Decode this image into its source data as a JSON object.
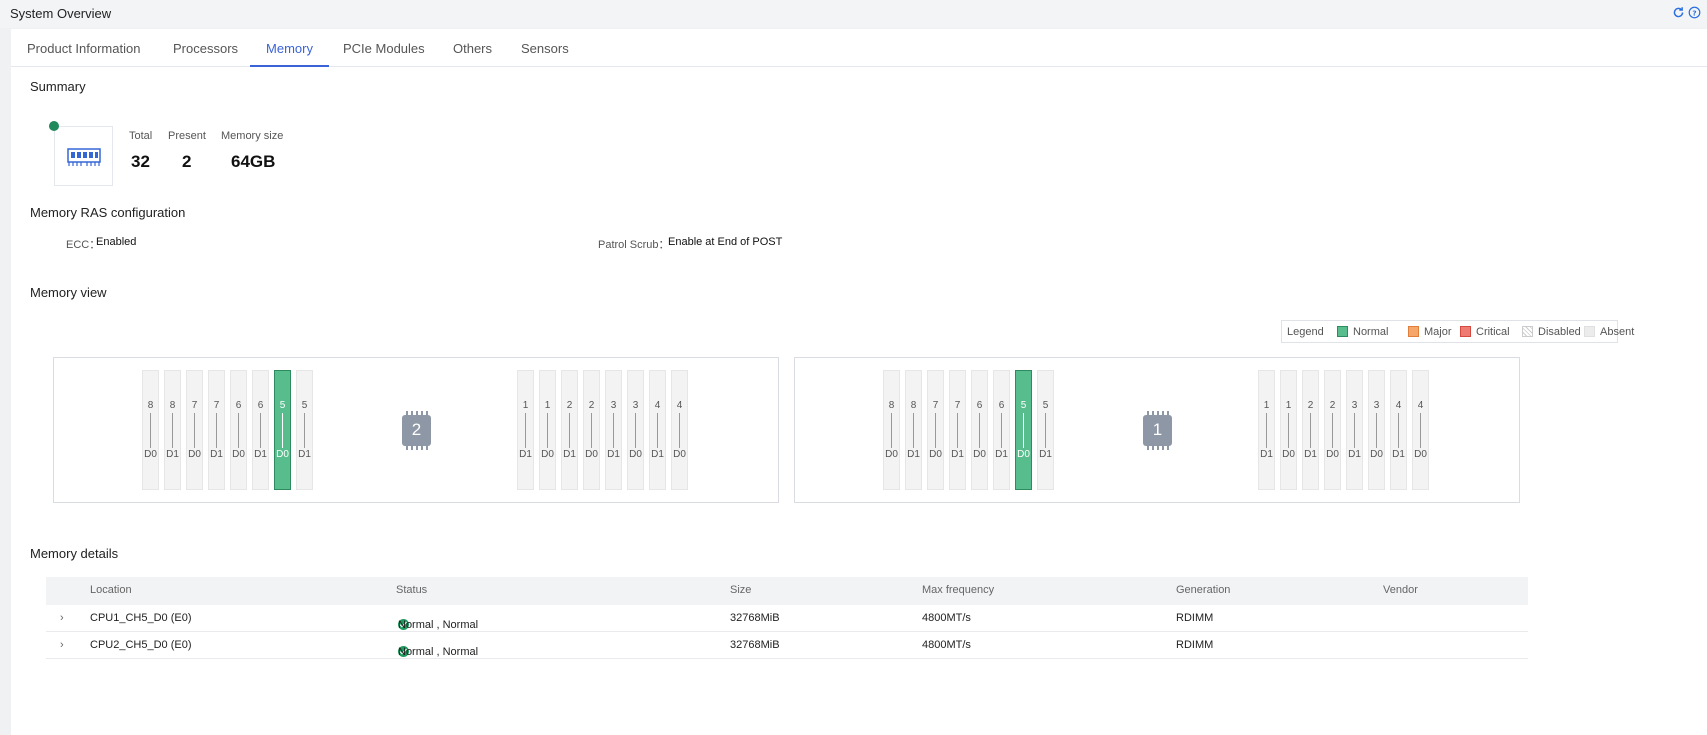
{
  "header": {
    "title": "System Overview",
    "refresh_icon": "refresh-icon",
    "help_icon": "help-icon"
  },
  "tabs": [
    {
      "label": "Product Information"
    },
    {
      "label": "Processors"
    },
    {
      "label": "Memory",
      "active": true
    },
    {
      "label": "PCIe Modules"
    },
    {
      "label": "Others"
    },
    {
      "label": "Sensors"
    }
  ],
  "summary": {
    "title": "Summary",
    "status_color": "#1f8a5c",
    "total_label": "Total",
    "total_value": "32",
    "present_label": "Present",
    "present_value": "2",
    "size_label": "Memory size",
    "size_value": "64GB"
  },
  "ras": {
    "title": "Memory RAS configuration",
    "ecc_label": "ECC：",
    "ecc_value": "Enabled",
    "patrol_label": "Patrol Scrub：",
    "patrol_value": "Enable at End of POST"
  },
  "memory_view": {
    "title": "Memory view",
    "legend": {
      "title": "Legend",
      "items": [
        {
          "label": "Normal",
          "color": "#58bd8c"
        },
        {
          "label": "Major",
          "color": "#f5a76a"
        },
        {
          "label": "Critical",
          "color": "#ef7a72"
        },
        {
          "label": "Disabled",
          "color": "#f2f2f2"
        },
        {
          "label": "Absent",
          "color": "#ececec"
        }
      ]
    },
    "cpus": [
      {
        "label": "2",
        "slots": [
          {
            "num": "8",
            "dimm": "D0",
            "state": "absent"
          },
          {
            "num": "8",
            "dimm": "D1",
            "state": "absent"
          },
          {
            "num": "7",
            "dimm": "D0",
            "state": "absent"
          },
          {
            "num": "7",
            "dimm": "D1",
            "state": "absent"
          },
          {
            "num": "6",
            "dimm": "D0",
            "state": "absent"
          },
          {
            "num": "6",
            "dimm": "D1",
            "state": "absent"
          },
          {
            "num": "5",
            "dimm": "D0",
            "state": "normal"
          },
          {
            "num": "5",
            "dimm": "D1",
            "state": "absent"
          },
          {
            "num": "1",
            "dimm": "D1",
            "state": "absent"
          },
          {
            "num": "1",
            "dimm": "D0",
            "state": "absent"
          },
          {
            "num": "2",
            "dimm": "D1",
            "state": "absent"
          },
          {
            "num": "2",
            "dimm": "D0",
            "state": "absent"
          },
          {
            "num": "3",
            "dimm": "D1",
            "state": "absent"
          },
          {
            "num": "3",
            "dimm": "D0",
            "state": "absent"
          },
          {
            "num": "4",
            "dimm": "D1",
            "state": "absent"
          },
          {
            "num": "4",
            "dimm": "D0",
            "state": "absent"
          }
        ]
      },
      {
        "label": "1",
        "slots": [
          {
            "num": "8",
            "dimm": "D0",
            "state": "absent"
          },
          {
            "num": "8",
            "dimm": "D1",
            "state": "absent"
          },
          {
            "num": "7",
            "dimm": "D0",
            "state": "absent"
          },
          {
            "num": "7",
            "dimm": "D1",
            "state": "absent"
          },
          {
            "num": "6",
            "dimm": "D0",
            "state": "absent"
          },
          {
            "num": "6",
            "dimm": "D1",
            "state": "absent"
          },
          {
            "num": "5",
            "dimm": "D0",
            "state": "normal"
          },
          {
            "num": "5",
            "dimm": "D1",
            "state": "absent"
          },
          {
            "num": "1",
            "dimm": "D1",
            "state": "absent"
          },
          {
            "num": "1",
            "dimm": "D0",
            "state": "absent"
          },
          {
            "num": "2",
            "dimm": "D1",
            "state": "absent"
          },
          {
            "num": "2",
            "dimm": "D0",
            "state": "absent"
          },
          {
            "num": "3",
            "dimm": "D1",
            "state": "absent"
          },
          {
            "num": "3",
            "dimm": "D0",
            "state": "absent"
          },
          {
            "num": "4",
            "dimm": "D1",
            "state": "absent"
          },
          {
            "num": "4",
            "dimm": "D0",
            "state": "absent"
          }
        ]
      }
    ]
  },
  "details": {
    "title": "Memory details",
    "columns": [
      "Location",
      "Status",
      "Size",
      "Max frequency",
      "Generation",
      "Vendor"
    ],
    "rows": [
      {
        "location": "CPU1_CH5_D0 (E0)",
        "status": "Normal , Normal",
        "size": "32768MiB",
        "freq": "4800MT/s",
        "generation": "RDIMM",
        "vendor": ""
      },
      {
        "location": "CPU2_CH5_D0 (E0)",
        "status": "Normal , Normal",
        "size": "32768MiB",
        "freq": "4800MT/s",
        "generation": "RDIMM",
        "vendor": ""
      }
    ]
  }
}
